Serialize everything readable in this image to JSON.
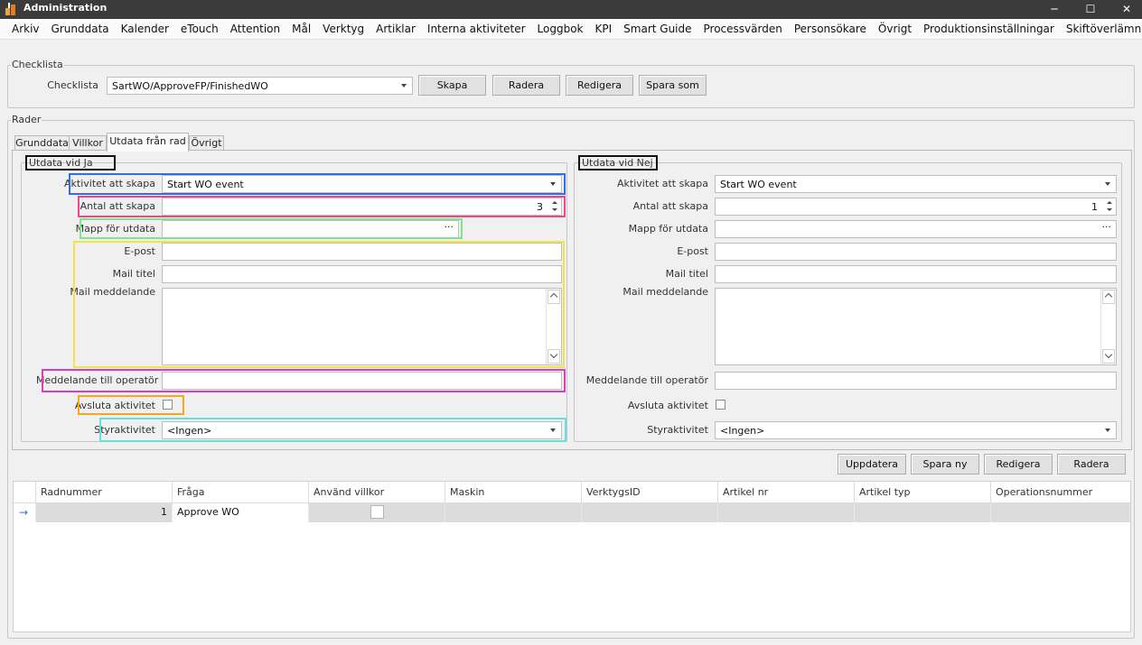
{
  "window": {
    "title": "Administration",
    "minimize": "─",
    "maximize": "☐",
    "close": "✕"
  },
  "menu": [
    "Arkiv",
    "Grunddata",
    "Kalender",
    "eTouch",
    "Attention",
    "Mål",
    "Verktyg",
    "Artiklar",
    "Interna aktiviteter",
    "Loggbok",
    "KPI",
    "Smart Guide",
    "Processvärden",
    "Personsökare",
    "Övrigt",
    "Produktionsinställningar",
    "Skiftöverlämning"
  ],
  "checklist": {
    "group_title": "Checklista",
    "label": "Checklista",
    "selected": "SartWO/ApproveFP/FinishedWO",
    "buttons": {
      "create": "Skapa",
      "delete": "Radera",
      "edit": "Redigera",
      "save_as": "Spara som"
    }
  },
  "rows": {
    "group_title": "Rader",
    "tabs": [
      "Grunddata",
      "Villkor",
      "Utdata från rad",
      "Övrigt"
    ],
    "active_tab": "Utdata från rad"
  },
  "output_yes": {
    "title": "Utdata vid Ja",
    "activity_label": "Aktivitet att skapa",
    "activity_value": "Start WO event",
    "count_label": "Antal att skapa",
    "count_value": "3",
    "folder_label": "Mapp för utdata",
    "folder_value": "",
    "email_label": "E-post",
    "mail_title_label": "Mail titel",
    "mail_message_label": "Mail meddelande",
    "operator_message_label": "Meddelande till operatör",
    "finish_activity_label": "Avsluta aktivitet",
    "control_activity_label": "Styraktivitet",
    "control_activity_value": "<Ingen>"
  },
  "output_no": {
    "title": "Utdata vid Nej",
    "activity_label": "Aktivitet att skapa",
    "activity_value": "Start WO event",
    "count_label": "Antal att skapa",
    "count_value": "1",
    "folder_label": "Mapp för utdata",
    "folder_value": "",
    "email_label": "E-post",
    "mail_title_label": "Mail titel",
    "mail_message_label": "Mail meddelande",
    "operator_message_label": "Meddelande till operatör",
    "finish_activity_label": "Avsluta aktivitet",
    "control_activity_label": "Styraktivitet",
    "control_activity_value": "<Ingen>"
  },
  "row_buttons": {
    "update": "Uppdatera",
    "save_new": "Spara ny",
    "edit": "Redigera",
    "delete": "Radera"
  },
  "grid": {
    "columns": [
      "Radnummer",
      "Fråga",
      "Använd villkor",
      "Maskin",
      "VerktygsID",
      "Artikel nr",
      "Artikel typ",
      "Operationsnummer"
    ],
    "row_marker": "→",
    "rows": [
      {
        "radnummer": "1",
        "fraga": "Approve WO",
        "anvand_villkor": "",
        "maskin": "",
        "verktygsid": "",
        "artikel_nr": "",
        "artikel_typ": "",
        "operationsnummer": ""
      }
    ]
  },
  "highlight_colors": {
    "black": "#111111",
    "blue": "#2f6fe0",
    "pink": "#f0468c",
    "green": "#7fe58a",
    "yellow": "#f3e34b",
    "magenta": "#d93fb8",
    "orange": "#f5a623",
    "cyan": "#5fe1dc"
  }
}
